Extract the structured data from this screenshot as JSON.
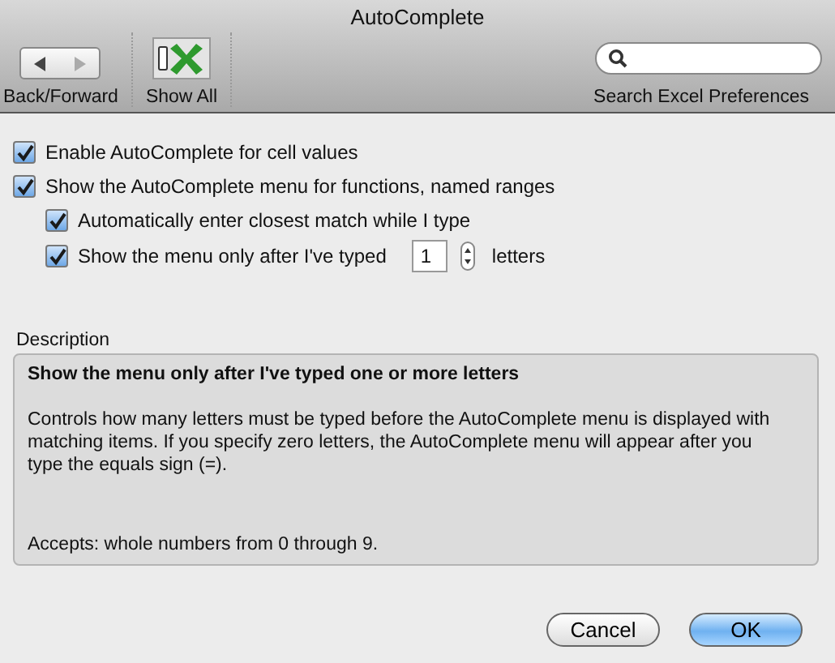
{
  "window": {
    "title": "AutoComplete"
  },
  "toolbar": {
    "back_forward": {
      "label": "Back/Forward"
    },
    "show_all": {
      "label": "Show All"
    },
    "search": {
      "label": "Search Excel Preferences"
    }
  },
  "options": [
    {
      "kind": "plain",
      "label": "Enable AutoComplete for cell values",
      "checked": true
    },
    {
      "kind": "plain",
      "label": "Show the AutoComplete menu for functions, named ranges",
      "checked": true,
      "children": [
        {
          "kind": "plain",
          "label": "Automatically enter closest match while I type",
          "checked": true
        },
        {
          "kind": "count",
          "label": "Show the menu only after I've typed",
          "checked": true,
          "value": "1",
          "suffix": "letters"
        }
      ]
    }
  ],
  "description": {
    "label": "Description",
    "heading": "Show the menu only after I've typed one or more letters",
    "body": "Controls how many letters must be typed before the AutoComplete menu is displayed with matching items. If you specify zero letters, the AutoComplete menu will appear after you type the equals sign (=).",
    "accepts": "Accepts:  whole numbers from 0 through 9."
  },
  "buttons": [
    {
      "label": "Cancel",
      "kind": "secondary"
    },
    {
      "label": "OK",
      "kind": "default"
    }
  ]
}
